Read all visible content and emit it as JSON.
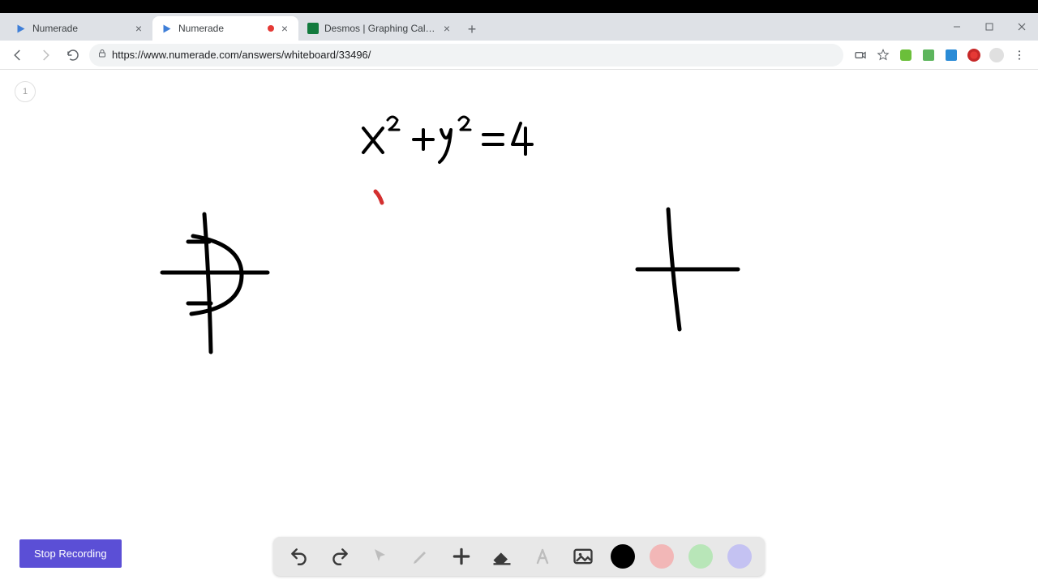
{
  "tabs": [
    {
      "title": "Numerade",
      "favicon": "numerade"
    },
    {
      "title": "Numerade",
      "favicon": "numerade",
      "recording": true
    },
    {
      "title": "Desmos | Graphing Calculator",
      "favicon": "desmos"
    }
  ],
  "active_tab_index": 1,
  "url": "https://www.numerade.com/answers/whiteboard/33496/",
  "page_badge": "1",
  "stop_recording_label": "Stop Recording",
  "whiteboard": {
    "equation": "x² + y² = 4",
    "red_mark_note": "small red tick below equation",
    "sketches": [
      "left-axes-with-half-circle-right",
      "right-axes-plain"
    ]
  },
  "palette": {
    "tools": {
      "undo": "undo-icon",
      "redo": "redo-icon",
      "pointer": "pointer-icon",
      "pencil": "pencil-icon",
      "add": "plus-icon",
      "eraser": "eraser-icon",
      "text": "text-icon",
      "image": "image-icon"
    },
    "colors": {
      "black": "#000000",
      "pink": "#f2b7b7",
      "green": "#b8e6b8",
      "lavender": "#c4c2f2"
    }
  },
  "window_controls": {
    "min": "–",
    "max": "▢",
    "close": "✕"
  },
  "nav": {
    "back": "←",
    "forward": "→",
    "reload": "⟳"
  },
  "addr_icons": {
    "secure": "lock-icon"
  },
  "extensions": [
    "camera-icon",
    "star-icon",
    "ext-green-icon",
    "ext-ublock-icon",
    "ext-check-icon",
    "ext-g-icon",
    "avatar-icon",
    "menu-icon"
  ]
}
